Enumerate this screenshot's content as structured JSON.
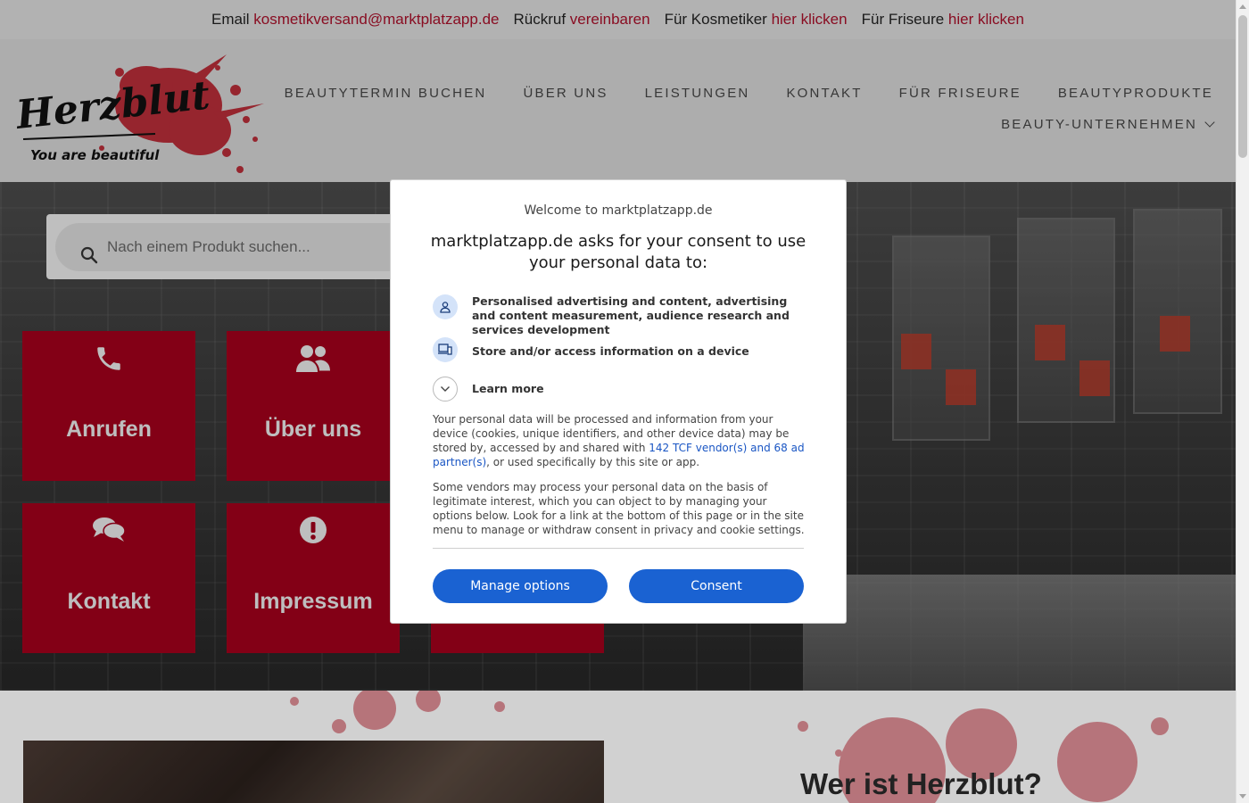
{
  "topbar": {
    "email_label": "Email",
    "email_link": "kosmetikversand@marktplatzapp.de",
    "callback_label": "Rückruf",
    "callback_link": "vereinbaren",
    "cosmetician_label": "Für Kosmetiker",
    "cosmetician_link": "hier klicken",
    "hairdresser_label": "Für Friseure",
    "hairdresser_link": "hier klicken",
    "link_color": "#a8102a"
  },
  "logo": {
    "name": "Herzblut",
    "tagline": "You are beautiful"
  },
  "nav": {
    "items": [
      "BEAUTYTERMIN BUCHEN",
      "ÜBER UNS",
      "LEISTUNGEN",
      "KONTAKT",
      "FÜR FRISEURE",
      "BEAUTYPRODUKTE"
    ],
    "dropdown": "BEAUTY-UNTERNEHMEN"
  },
  "search": {
    "placeholder": "Nach einem Produkt suchen..."
  },
  "tiles": [
    {
      "label": "Anrufen",
      "icon": "phone-icon"
    },
    {
      "label": "Über uns",
      "icon": "users-icon"
    },
    {
      "label": "Kontakt",
      "icon": "comments-icon"
    },
    {
      "label": "Impressum",
      "icon": "exclamation-icon"
    }
  ],
  "tile_color": "#a0001c",
  "section": {
    "title": "Wer ist Herzblut?"
  },
  "consent": {
    "welcome": "Welcome to marktplatzapp.de",
    "heading": "marktplatzapp.de asks for your consent to use your personal data to:",
    "purposes": [
      {
        "text": "Personalised advertising and content, advertising and content measurement, audience research and services development",
        "icon": "person-icon"
      },
      {
        "text": "Store and/or access information on a device",
        "icon": "devices-icon"
      }
    ],
    "learn_more": "Learn more",
    "para1_before": "Your personal data will be processed and information from your device (cookies, unique identifiers, and other device data) may be stored by, accessed by and shared with ",
    "para1_link": "142 TCF vendor(s) and 68 ad partner(s)",
    "para1_after": ", or used specifically by this site or app.",
    "para2": "Some vendors may process your personal data on the basis of legitimate interest, which you can object to by managing your options below. Look for a link at the bottom of this page or in the site menu to manage or withdraw consent in privacy and cookie settings.",
    "manage_button": "Manage options",
    "consent_button": "Consent",
    "button_color": "#1a62d2"
  }
}
